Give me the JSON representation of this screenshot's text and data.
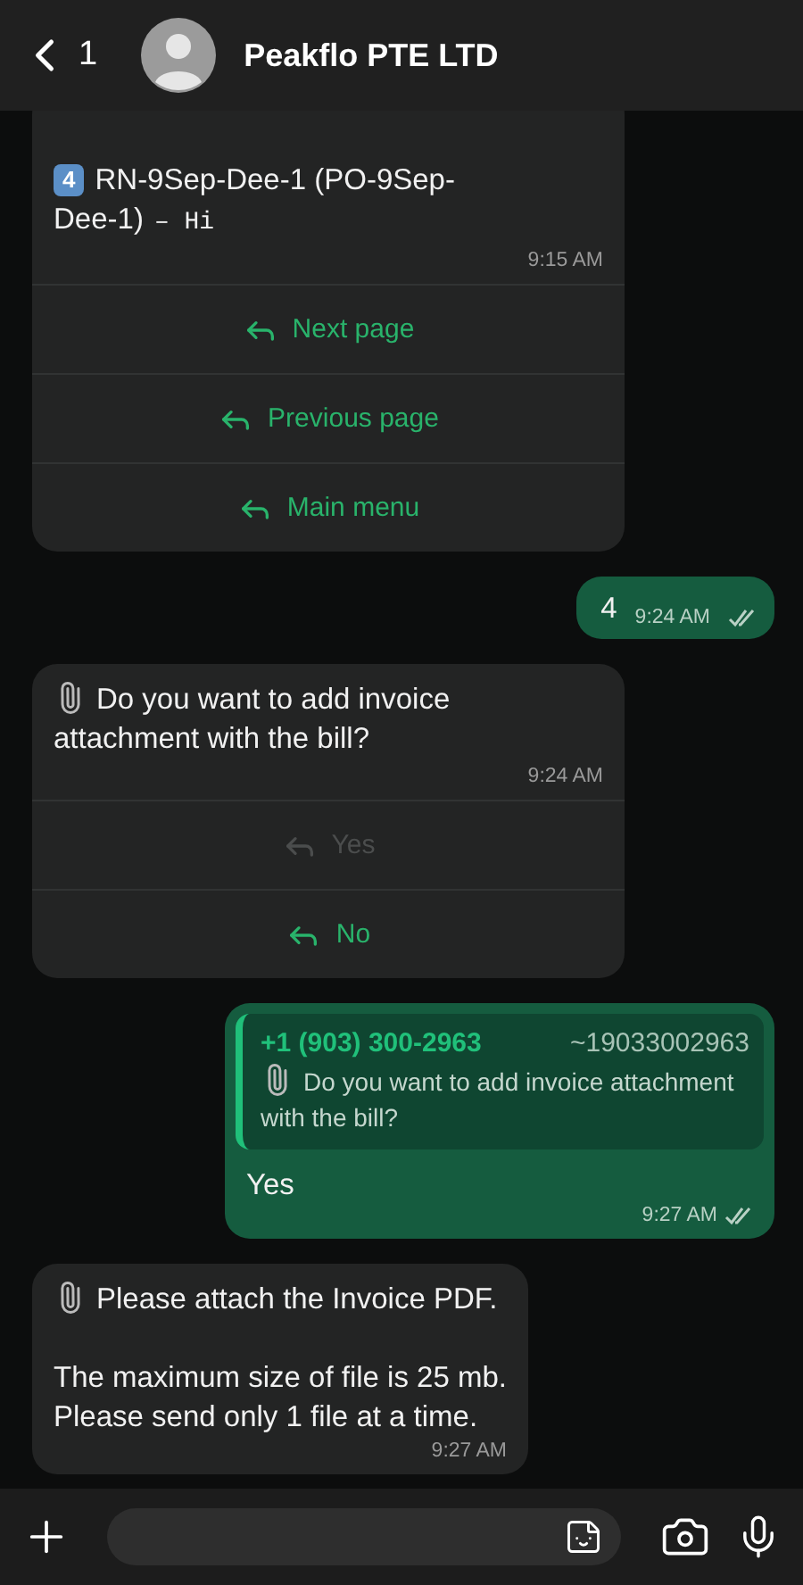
{
  "header": {
    "back_count": "1",
    "title": "Peakflo PTE LTD"
  },
  "messages": [
    {
      "kind": "incoming",
      "badge": "4",
      "text": "RN-9Sep-Dee-1 (PO-9Sep-Dee-1)",
      "suffix": "– Hi",
      "time": "9:15 AM",
      "buttons": [
        {
          "label": "Next page",
          "disabled": false
        },
        {
          "label": "Previous page",
          "disabled": false
        },
        {
          "label": "Main menu",
          "disabled": false
        }
      ]
    },
    {
      "kind": "outgoing",
      "text": "4",
      "time": "9:24 AM",
      "read": true
    },
    {
      "kind": "incoming",
      "attachment": true,
      "text": "Do you want to add invoice attachment with the bill?",
      "time": "9:24 AM",
      "buttons": [
        {
          "label": "Yes",
          "disabled": true
        },
        {
          "label": "No",
          "disabled": false
        }
      ]
    },
    {
      "kind": "outgoing",
      "quote": {
        "author": "+1 (903) 300-2963",
        "number": "~19033002963",
        "attachment": true,
        "text": "Do you want to add invoice attachment with the bill?"
      },
      "text": "Yes",
      "time": "9:27 AM",
      "read": true
    },
    {
      "kind": "incoming",
      "attachment": true,
      "text": "Please attach the Invoice PDF.\n\nThe maximum size of file is 25 mb.\nPlease send only 1 file at a time.",
      "time": "9:27 AM"
    }
  ]
}
